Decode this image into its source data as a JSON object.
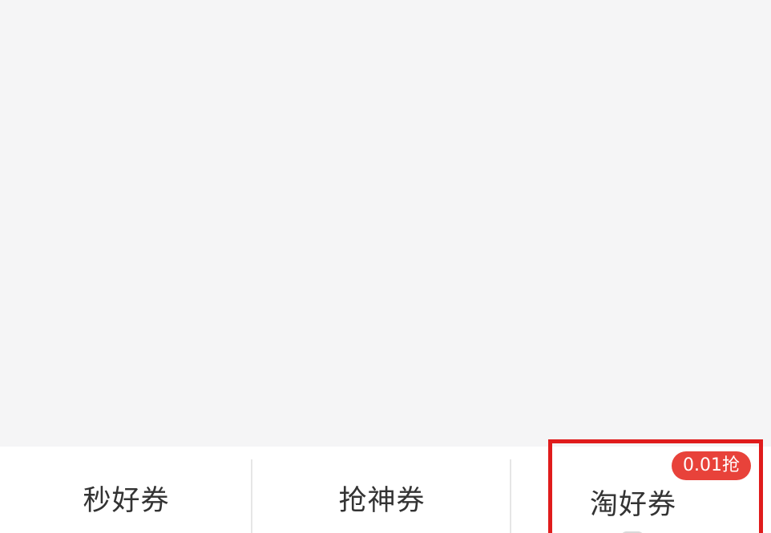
{
  "bottom_tabs": {
    "items": [
      {
        "label": "秒好券"
      },
      {
        "label": "抢神券"
      },
      {
        "label": "淘好券",
        "badge": "0.01抢"
      }
    ]
  },
  "colors": {
    "background": "#f5f5f6",
    "tab_bar_bg": "#ffffff",
    "badge_bg": "#e8423a",
    "highlight_border": "#e01c1c",
    "text": "#333333"
  }
}
